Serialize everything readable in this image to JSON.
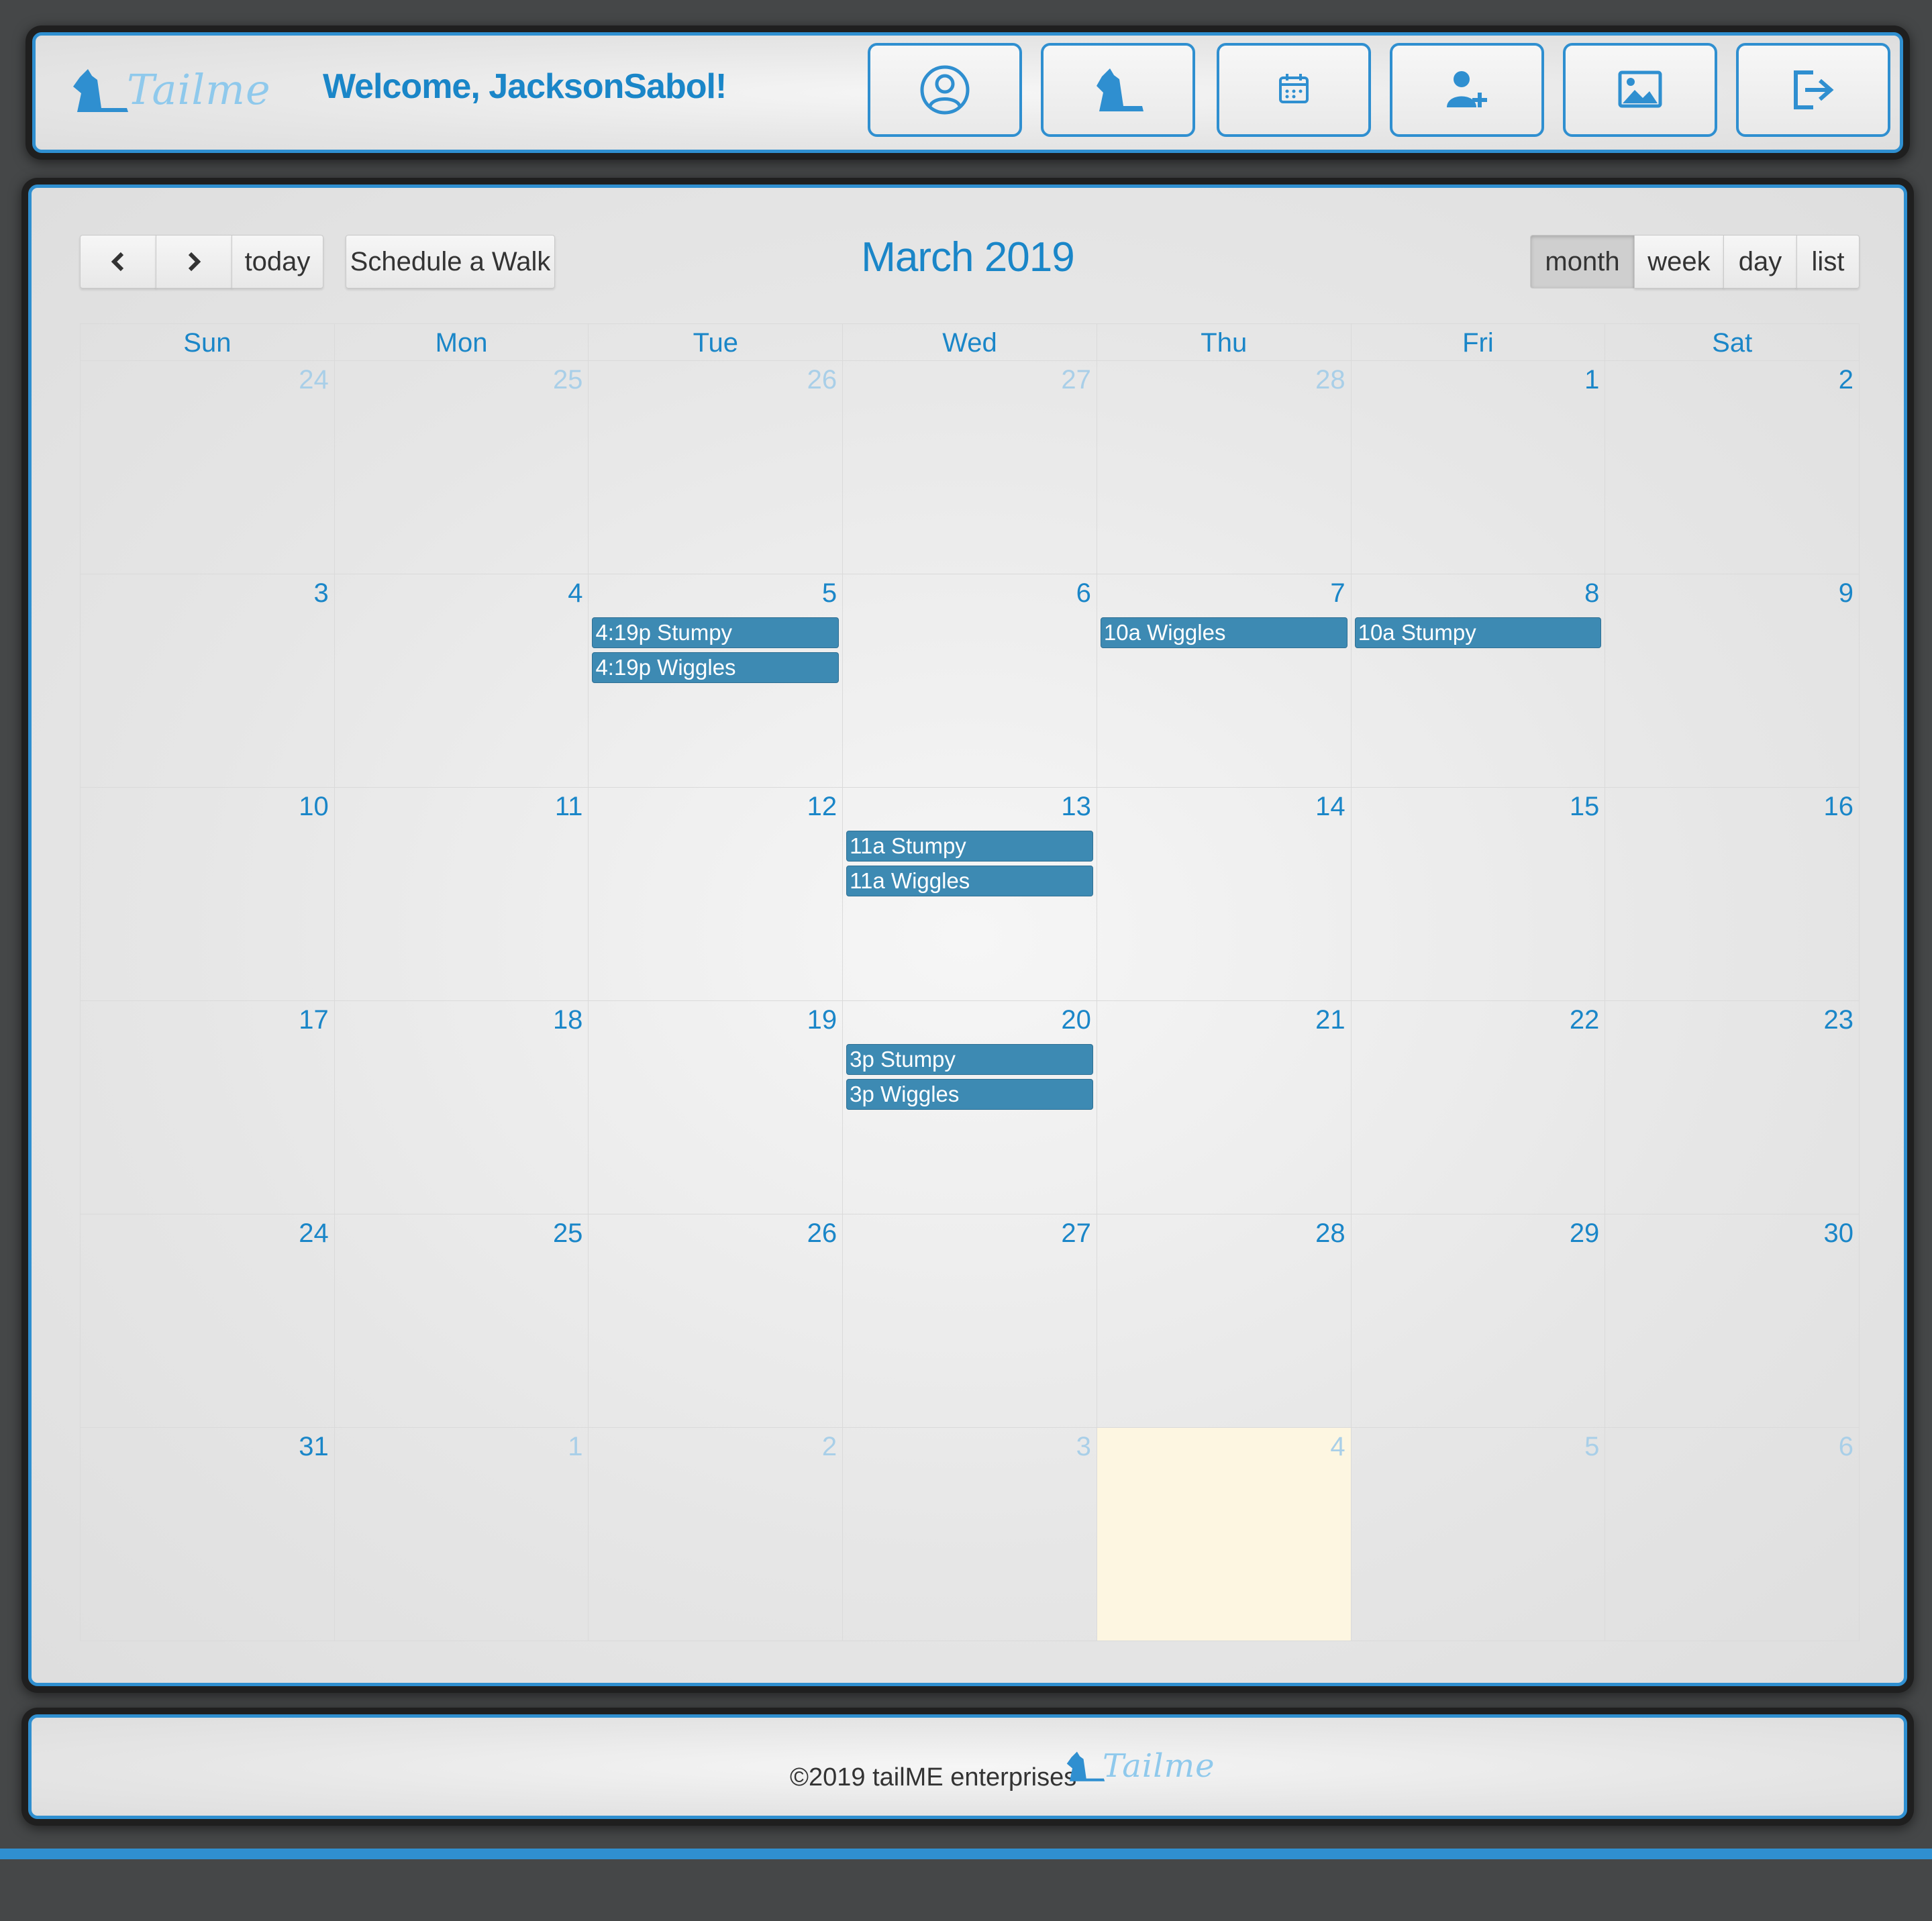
{
  "header": {
    "logo_text": "Tailme",
    "welcome": "Welcome, JacksonSabol!",
    "buttons": [
      {
        "icon": "user-circle-icon"
      },
      {
        "icon": "dog-icon"
      },
      {
        "icon": "calendar-icon"
      },
      {
        "icon": "add-user-icon"
      },
      {
        "icon": "image-icon"
      },
      {
        "icon": "logout-icon"
      }
    ]
  },
  "toolbar": {
    "prev_icon": "chevron-left-icon",
    "next_icon": "chevron-right-icon",
    "today_label": "today",
    "schedule_label": "Schedule a Walk",
    "title": "March 2019",
    "views": [
      "month",
      "week",
      "day",
      "list"
    ],
    "active_view": "month"
  },
  "calendar": {
    "days_of_week": [
      "Sun",
      "Mon",
      "Tue",
      "Wed",
      "Thu",
      "Fri",
      "Sat"
    ],
    "weeks": [
      [
        {
          "n": "24",
          "other": true
        },
        {
          "n": "25",
          "other": true
        },
        {
          "n": "26",
          "other": true
        },
        {
          "n": "27",
          "other": true
        },
        {
          "n": "28",
          "other": true
        },
        {
          "n": "1"
        },
        {
          "n": "2"
        }
      ],
      [
        {
          "n": "3"
        },
        {
          "n": "4"
        },
        {
          "n": "5",
          "events": [
            "4:19p Stumpy",
            "4:19p Wiggles"
          ]
        },
        {
          "n": "6"
        },
        {
          "n": "7",
          "events": [
            "10a Wiggles"
          ]
        },
        {
          "n": "8",
          "events": [
            "10a Stumpy"
          ]
        },
        {
          "n": "9"
        }
      ],
      [
        {
          "n": "10"
        },
        {
          "n": "11"
        },
        {
          "n": "12"
        },
        {
          "n": "13",
          "events": [
            "11a Stumpy",
            "11a Wiggles"
          ]
        },
        {
          "n": "14"
        },
        {
          "n": "15"
        },
        {
          "n": "16"
        }
      ],
      [
        {
          "n": "17"
        },
        {
          "n": "18"
        },
        {
          "n": "19"
        },
        {
          "n": "20",
          "events": [
            "3p Stumpy",
            "3p Wiggles"
          ]
        },
        {
          "n": "21"
        },
        {
          "n": "22"
        },
        {
          "n": "23"
        }
      ],
      [
        {
          "n": "24"
        },
        {
          "n": "25"
        },
        {
          "n": "26"
        },
        {
          "n": "27"
        },
        {
          "n": "28"
        },
        {
          "n": "29"
        },
        {
          "n": "30"
        }
      ],
      [
        {
          "n": "31"
        },
        {
          "n": "1",
          "other": true
        },
        {
          "n": "2",
          "other": true
        },
        {
          "n": "3",
          "other": true
        },
        {
          "n": "4",
          "other": true,
          "today": true
        },
        {
          "n": "5",
          "other": true
        },
        {
          "n": "6",
          "other": true
        }
      ]
    ]
  },
  "footer": {
    "text": "©2019 tailME enterprises",
    "logo_text": "Tailme"
  },
  "colors": {
    "accent": "#2f8fd0",
    "event": "#3d8ab3",
    "today_bg": "#fdf6e1",
    "background": "#454748"
  }
}
